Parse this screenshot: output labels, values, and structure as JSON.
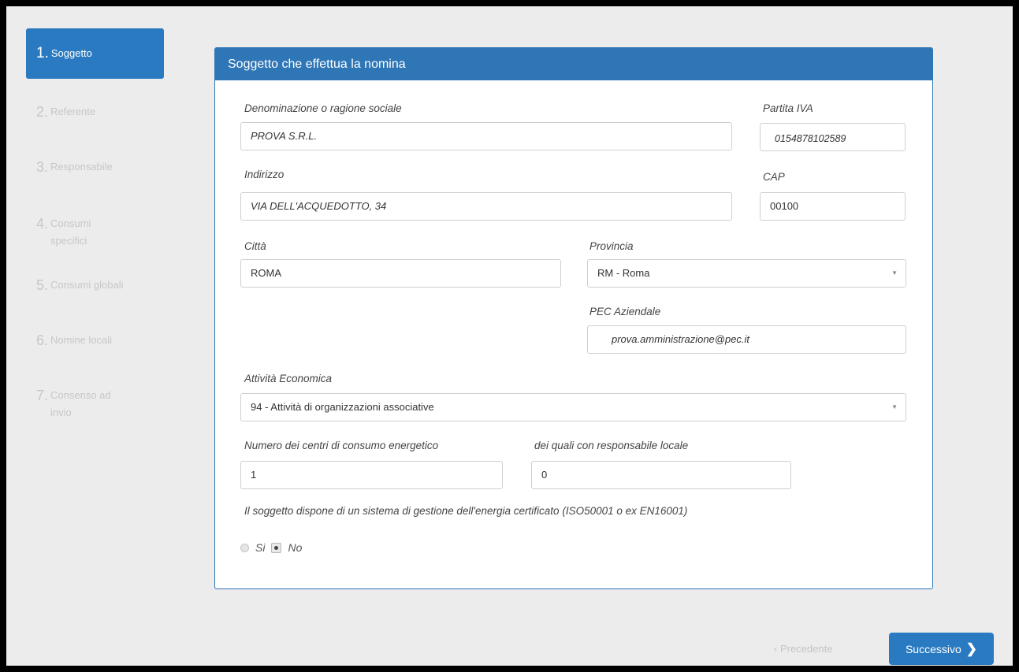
{
  "wizard": {
    "steps": [
      {
        "num": "1.",
        "label": "Soggetto"
      },
      {
        "num": "2.",
        "label": "Referente"
      },
      {
        "num": "3.",
        "label": "Responsabile"
      },
      {
        "num": "4.",
        "label": "Consumi specifici"
      },
      {
        "num": "5.",
        "label": "Consumi globali"
      },
      {
        "num": "6.",
        "label": "Nomine locali"
      },
      {
        "num": "7.",
        "label": "Consenso ad invio"
      }
    ],
    "active_step": 1
  },
  "panel": {
    "title": "Soggetto che effettua la nomina"
  },
  "form": {
    "denominazione": {
      "label": "Denominazione o ragione sociale",
      "value": "PROVA S.R.L."
    },
    "partita_iva": {
      "label": "Partita IVA",
      "value": "0154878102589"
    },
    "indirizzo": {
      "label": "Indirizzo",
      "value": "VIA DELL'ACQUEDOTTO, 34"
    },
    "cap": {
      "label": "CAP",
      "value": "00100"
    },
    "citta": {
      "label": "Città",
      "value": "ROMA"
    },
    "provincia": {
      "label": "Provincia",
      "value": "RM - Roma"
    },
    "pec": {
      "label": "PEC Aziendale",
      "value": "prova.amministrazione@pec.it"
    },
    "attivita": {
      "label": "Attività Economica",
      "value": "94 - Attività di organizzazioni associative"
    },
    "centri": {
      "label": "Numero dei centri di consumo energetico",
      "value": "1"
    },
    "responsabile_locale": {
      "label": "dei quali con responsabile locale",
      "value": "0"
    },
    "sistema_gestione": {
      "question": "Il soggetto dispone di un sistema di gestione dell'energia certificato (ISO50001 o ex EN16001)",
      "options": [
        "Si",
        "No"
      ],
      "selected": "No"
    }
  },
  "navigation": {
    "prev_label": "‹ Precedente",
    "next_label": "Successivo"
  }
}
